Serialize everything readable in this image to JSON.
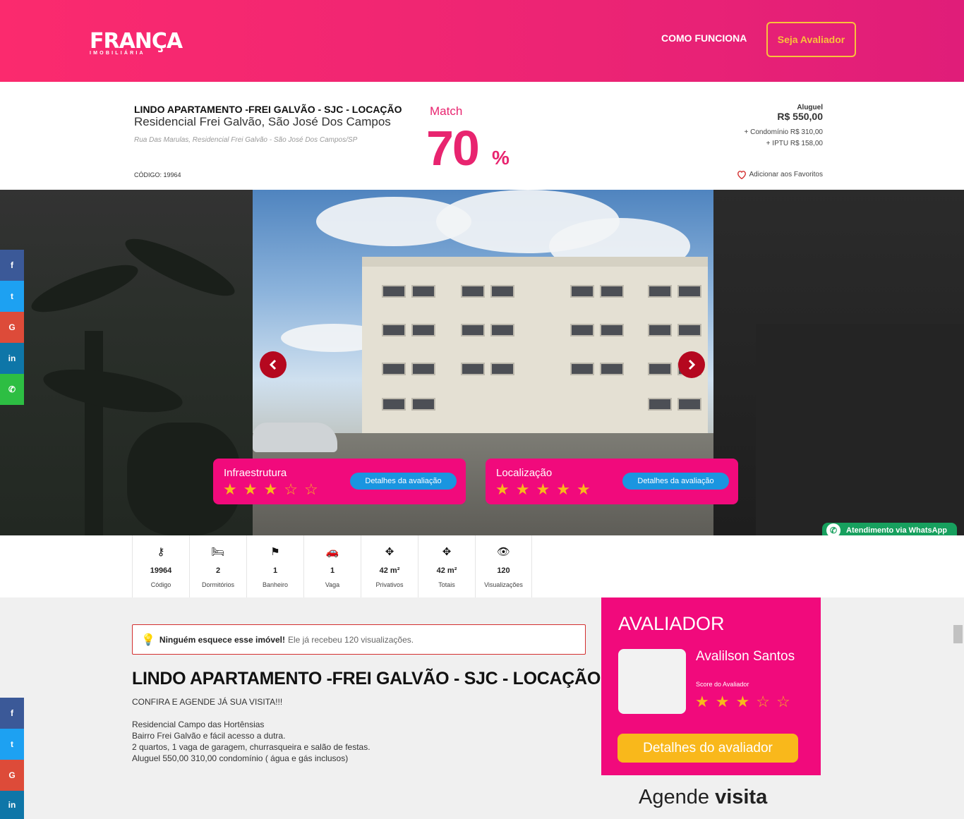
{
  "header": {
    "logo_main": "FRANÇA",
    "logo_sub": "IMOBILIÁRIA",
    "nav_link": "COMO FUNCIONA",
    "cta": "Seja Avaliador"
  },
  "property": {
    "title": "LINDO APARTAMENTO -FREI GALVÃO - SJC - LOCAÇÃO",
    "subtitle": "Residencial Frei Galvão, São José Dos Campos",
    "address": "Rua Das Marulas, Residencial Frei Galvão - São José Dos Campos/SP",
    "code": "CÓDIGO: 19964",
    "match_label": "Match",
    "match_value": "70",
    "match_unit": "%",
    "rent_label": "Aluguel",
    "rent_value": "R$ 550,00",
    "condo": "+ Condomínio R$ 310,00",
    "iptu": "+ IPTU R$ 158,00",
    "favorite": "Adicionar aos Favoritos"
  },
  "ratings": [
    {
      "title": "Infraestrutura",
      "stars": 3,
      "max": 5,
      "button": "Detalhes da avaliação"
    },
    {
      "title": "Localização",
      "stars": 5,
      "max": 5,
      "button": "Detalhes da avaliação"
    }
  ],
  "whatsapp": "Atendimento via WhatsApp",
  "share_icons": [
    "facebook-icon",
    "twitter-icon",
    "google-icon",
    "linkedin-icon",
    "whatsapp-icon"
  ],
  "features": [
    {
      "icon": "key-icon",
      "value": "19964",
      "label": "Código"
    },
    {
      "icon": "bed-icon",
      "value": "2",
      "label": "Dormitórios"
    },
    {
      "icon": "shower-icon",
      "value": "1",
      "label": "Banheiro"
    },
    {
      "icon": "car-icon",
      "value": "1",
      "label": "Vaga"
    },
    {
      "icon": "move-icon",
      "value": "42 m²",
      "label": "Privativos"
    },
    {
      "icon": "move-icon",
      "value": "42 m²",
      "label": "Totais"
    },
    {
      "icon": "eye-icon",
      "value": "120",
      "label": "Visualizações"
    }
  ],
  "alert": {
    "strong": "Ninguém esquece esse imóvel!",
    "rest": "Ele já recebeu 120 visualizações."
  },
  "description": {
    "title": "LINDO APARTAMENTO -FREI GALVÃO - SJC - LOCAÇÃO",
    "lines": [
      "CONFIRA E AGENDE JÁ SUA VISITA!!!",
      "Residencial Campo das Hortênsias",
      "Bairro Frei Galvão e fácil acesso a dutra.",
      "2 quartos, 1 vaga de garagem, churrasqueira e salão de festas.",
      "Aluguel 550,00 310,00 condomínio ( água e gás inclusos)"
    ]
  },
  "evaluator": {
    "heading": "AVALIADOR",
    "name": "Avalilson Santos",
    "score_label": "Score do Avaliador",
    "stars": 3,
    "max": 5,
    "button": "Detalhes do avaliador"
  },
  "schedule": {
    "light": "Agende",
    "bold": "visita"
  },
  "colors": {
    "brand_pink": "#f10a7c",
    "accent_yellow": "#f9b81b",
    "button_blue": "#1a95e0"
  }
}
